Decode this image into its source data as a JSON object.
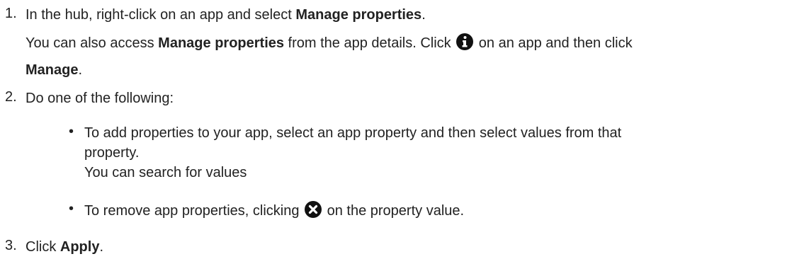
{
  "step1": {
    "number": "1.",
    "line1": {
      "text": "In the hub, right-click on an app and select ",
      "bold": "Manage properties",
      "end": "."
    },
    "line2": {
      "pre": "You can also access ",
      "bold": "Manage properties",
      "mid": " from the app details. Click ",
      "icon": "info-circle-icon",
      "post": " on an app and then click"
    },
    "line3": {
      "bold": "Manage",
      "end": "."
    }
  },
  "step2": {
    "number": "2.",
    "text": "Do one of the following:",
    "bullets": [
      {
        "symbol": "•",
        "line1": "To add properties to your app, select an app property and then select values from that",
        "line2": "property.",
        "line3": "You can search for values"
      },
      {
        "symbol": "•",
        "pre": "To remove app properties, clicking ",
        "icon": "remove-circle-icon",
        "post": " on the property value."
      }
    ]
  },
  "step3": {
    "number": "3.",
    "pre": "Click ",
    "bold": "Apply",
    "end": "."
  }
}
